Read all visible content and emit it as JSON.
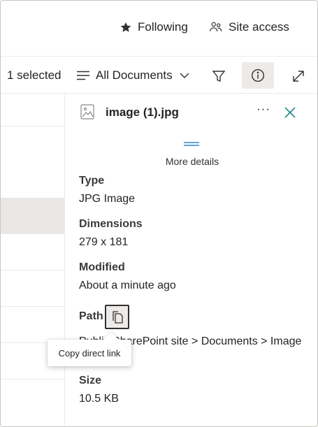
{
  "header": {
    "following_label": "Following",
    "site_access_label": "Site access"
  },
  "commandbar": {
    "selected_count": "1 selected",
    "view_label": "All Documents"
  },
  "details": {
    "file_name": "image (1).jpg",
    "more_label": "···",
    "more_details_label": "More details",
    "type_label": "Type",
    "type_value": "JPG Image",
    "dimensions_label": "Dimensions",
    "dimensions_value": "279 x 181",
    "modified_label": "Modified",
    "modified_value": "About a minute ago",
    "path_label": "Path",
    "path_value": "Public SharePoint site > Documents > Image (1).jpg",
    "size_label": "Size",
    "size_value": "10.5 KB"
  },
  "tooltip": {
    "copy_link_label": "Copy direct link"
  },
  "colors": {
    "accent": "#0f6cbd",
    "close_icon": "#238a85",
    "selected_row": "#e9e7e5"
  }
}
